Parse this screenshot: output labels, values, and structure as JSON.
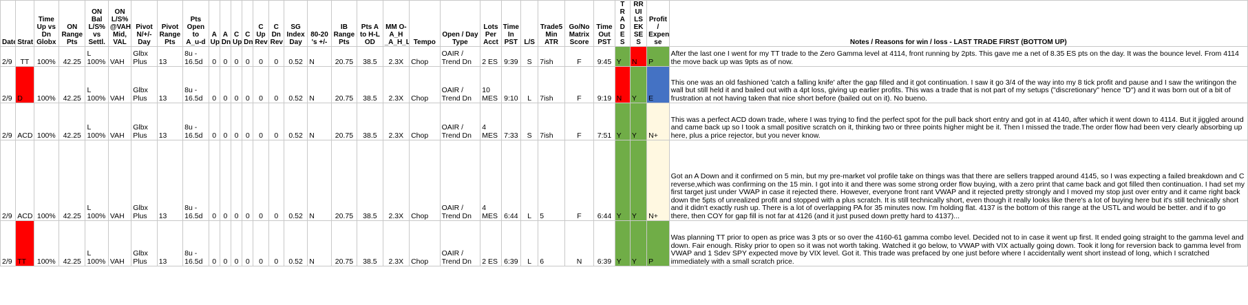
{
  "colors": {
    "green": "#70ad47",
    "red": "#ff0000",
    "blue": "#4472c4",
    "pale_yellow": "#fff8e1",
    "grid": "#c8c8c8"
  },
  "headers": {
    "date": "Date",
    "strat": "Strat",
    "time_up_dn": "Time Up vs Dn Globx",
    "on_range": "ON Range Pts",
    "on_bal": "ON Bal L/S% vs Settl.",
    "on_vah": "ON L/S% @VAH Mid, VAL",
    "pivot": "Pivot N/+/- Day",
    "pivot_range": "Pivot Range Pts",
    "pts_open": "Pts Open to A_u-d",
    "a_up": "A Up",
    "a_dn": "A Dn",
    "c_up": "C Up",
    "c_dn": "C Dn",
    "c_up_rev": "C Up Rev",
    "c_dn_rev": "C Dn Rev",
    "sg_index": "SG Index Day",
    "eighty_twenty": "80-20 's +/-",
    "ib_range": "IB Range Pts",
    "pts_a_hl": "Pts A to H-L OD",
    "mm": "MM O-A_H _A_H_L",
    "tempo": "Tempo",
    "open_day_type": "Open / Day Type",
    "lots": "Lots Per Acct",
    "time_in": "Time In PST",
    "ls": "L/S",
    "trade5": "Trade5 Min ATR",
    "go_no": "Go/No Matrix Score",
    "time_out": "Time Out PST",
    "trades_letters": [
      "T",
      "R",
      "A",
      "D",
      "E",
      "S"
    ],
    "risks_letters": [
      "R",
      "I",
      "S",
      "K",
      "E",
      "S"
    ],
    "rules_letters": [
      "R",
      "U",
      "L",
      "E",
      "S"
    ],
    "profit": "Profit / Expen se",
    "notes": "Notes / Reasons for win / loss - LAST TRADE FIRST (BOTTOM UP)"
  },
  "rows": [
    {
      "date": "2/9",
      "strat": "TT",
      "time_up_dn": "100%",
      "on_range": "42.25",
      "on_bal_1": "L",
      "on_bal_2": "100%",
      "on_vah": "VAH",
      "pivot_1": "Glbx",
      "pivot_2": "Plus",
      "pivot_range": "13",
      "pts_open_1": "8u -",
      "pts_open_2": "16.5d",
      "a_up": "0",
      "a_dn": "0",
      "c_up": "0",
      "c_dn": "0",
      "c_up_rev": "0",
      "c_dn_rev": "0",
      "sg_index": "0.52",
      "eighty_twenty": "N",
      "ib_range": "20.75",
      "pts_a_hl": "38.5",
      "mm": "2.3X",
      "tempo": "Chop",
      "open_type_1": "OAIR /",
      "open_type_2": "Trend Dn",
      "lots_1": "",
      "lots_2": "2 ES",
      "time_in": "9:39",
      "ls": "S",
      "trade5": "7ish",
      "go_no": "F",
      "time_out": "9:45",
      "trades": "Y",
      "rules": "N",
      "profit": "P",
      "note": "After the last one I went for my TT trade to the Zero Gamma level at 4114, front running by 2pts. This gave me a net of 8.35 ES pts on the day. It was the bounce level. From 4114 the move back up was 9pts as of now."
    },
    {
      "date": "2/9",
      "strat": "D",
      "time_up_dn": "100%",
      "on_range": "42.25",
      "on_bal_1": "L",
      "on_bal_2": "100%",
      "on_vah": "VAH",
      "pivot_1": "Glbx",
      "pivot_2": "Plus",
      "pivot_range": "13",
      "pts_open_1": "8u -",
      "pts_open_2": "16.5d",
      "a_up": "0",
      "a_dn": "0",
      "c_up": "0",
      "c_dn": "0",
      "c_up_rev": "0",
      "c_dn_rev": "0",
      "sg_index": "0.52",
      "eighty_twenty": "N",
      "ib_range": "20.75",
      "pts_a_hl": "38.5",
      "mm": "2.3X",
      "tempo": "Chop",
      "open_type_1": "OAIR /",
      "open_type_2": "Trend Dn",
      "lots_1": "10",
      "lots_2": "MES",
      "time_in": "9:10",
      "ls": "L",
      "trade5": "7ish",
      "go_no": "F",
      "time_out": "9:19",
      "trades": "N",
      "rules": "Y",
      "profit": "E",
      "note": "This one was an old fashioned 'catch a falling knife' after the gap filled and it got continuation. I saw it go 3/4 of the way into my 8 tick profit and pause and I saw the writingon the wall but still held it and bailed out with a 4pt loss, giving up earlier profits. This was a trade that is not part of my setups (\"discretionary\" hence \"D\") and it was born out of a bit of frustration at not having taken that nice short before (bailed out on it). No bueno."
    },
    {
      "date": "2/9",
      "strat": "ACD",
      "time_up_dn": "100%",
      "on_range": "42.25",
      "on_bal_1": "L",
      "on_bal_2": "100%",
      "on_vah": "VAH",
      "pivot_1": "Glbx",
      "pivot_2": "Plus",
      "pivot_range": "13",
      "pts_open_1": "8u -",
      "pts_open_2": "16.5d",
      "a_up": "0",
      "a_dn": "0",
      "c_up": "0",
      "c_dn": "0",
      "c_up_rev": "0",
      "c_dn_rev": "0",
      "sg_index": "0.52",
      "eighty_twenty": "N",
      "ib_range": "20.75",
      "pts_a_hl": "38.5",
      "mm": "2.3X",
      "tempo": "Chop",
      "open_type_1": "OAIR /",
      "open_type_2": "Trend Dn",
      "lots_1": "4",
      "lots_2": "MES",
      "time_in": "7:33",
      "ls": "S",
      "trade5": "7ish",
      "go_no": "F",
      "time_out": "7:51",
      "trades": "Y",
      "rules": "Y",
      "profit": "N+",
      "note": "This was a perfect ACD down trade, where I was trying to find the perfect spot for the pull back short entry and got in at 4140, after which it went down to 4114. But it jiggled around and came back up so I took a small positive scratch on it, thinking two or three points higher might be it. Then I missed the trade.The order flow had been very clearly absorbing up here, plus a price rejector, but you never know."
    },
    {
      "date": "2/9",
      "strat": "ACD",
      "time_up_dn": "100%",
      "on_range": "42.25",
      "on_bal_1": "L",
      "on_bal_2": "100%",
      "on_vah": "VAH",
      "pivot_1": "Glbx",
      "pivot_2": "Plus",
      "pivot_range": "13",
      "pts_open_1": "8u -",
      "pts_open_2": "16.5d",
      "a_up": "0",
      "a_dn": "0",
      "c_up": "0",
      "c_dn": "0",
      "c_up_rev": "0",
      "c_dn_rev": "0",
      "sg_index": "0.52",
      "eighty_twenty": "N",
      "ib_range": "20.75",
      "pts_a_hl": "38.5",
      "mm": "2.3X",
      "tempo": "Chop",
      "open_type_1": "OAIR /",
      "open_type_2": "Trend Dn",
      "lots_1": "4",
      "lots_2": "MES",
      "time_in": "6:44",
      "ls": "L",
      "trade5": "5",
      "go_no": "F",
      "time_out": "6:44",
      "trades": "Y",
      "rules": "Y",
      "profit": "N+",
      "note": "Got an A Down and it confirmed on 5 min, but my pre-market vol profile take on things was that there are sellers trapped around 4145, so I was expecting a failed breakdown and C reverse,which was confirming on the 15 min. I got into it and there was some strong order flow buying, with a zero print that came back and got filled then continuation. I had set my first target just under VWAP in case it rejected there. However, everyone front rant VWAP and it rejected pretty strongly and I moved my stop just over entry and it came right back down the 5pts of unrealized profit and stopped with a plus scratch. It is still technically short, even though it really looks like there's a lot of buying here but it's still technically short and it didn't exactly rush up. There is a lot of overlapping PA for 35 minutes now. I'm holding flat. 4137 is the bottom of this range at the USTL and would be better. and if to go there, then COY for gap fill is not far at 4126 (and it just pused down pretty hard to 4137)..."
    },
    {
      "date": "2/9",
      "strat": "TT",
      "time_up_dn": "100%",
      "on_range": "42.25",
      "on_bal_1": "L",
      "on_bal_2": "100%",
      "on_vah": "VAH",
      "pivot_1": "Glbx",
      "pivot_2": "Plus",
      "pivot_range": "13",
      "pts_open_1": "8u -",
      "pts_open_2": "16.5d",
      "a_up": "0",
      "a_dn": "0",
      "c_up": "0",
      "c_dn": "0",
      "c_up_rev": "0",
      "c_dn_rev": "0",
      "sg_index": "0.52",
      "eighty_twenty": "N",
      "ib_range": "20.75",
      "pts_a_hl": "38.5",
      "mm": "2.3X",
      "tempo": "Chop",
      "open_type_1": "OAIR /",
      "open_type_2": "Trend Dn",
      "lots_1": "",
      "lots_2": "2 ES",
      "time_in": "6:39",
      "ls": "L",
      "trade5": "6",
      "go_no": "N",
      "time_out": "6:39",
      "trades": "Y",
      "rules": "Y",
      "profit": "P",
      "note": "Was planning TT prior to open as price was 3 pts or so over the 4160-61 gamma combo level. Decided not to in case it went up first. It ended going straight to the gamma level and down. Fair enough. Risky prior to open so it was not worth taking. Watched it go below, to VWAP with VIX actually going down. Took it long for reversion back to gamma level from VWAP and 1 Sdev SPY expected move by VIX level. Got it. This trade was prefaced by one just before where I accidentally went short instead of long, which I scratched immediately with a small scratch price."
    }
  ]
}
